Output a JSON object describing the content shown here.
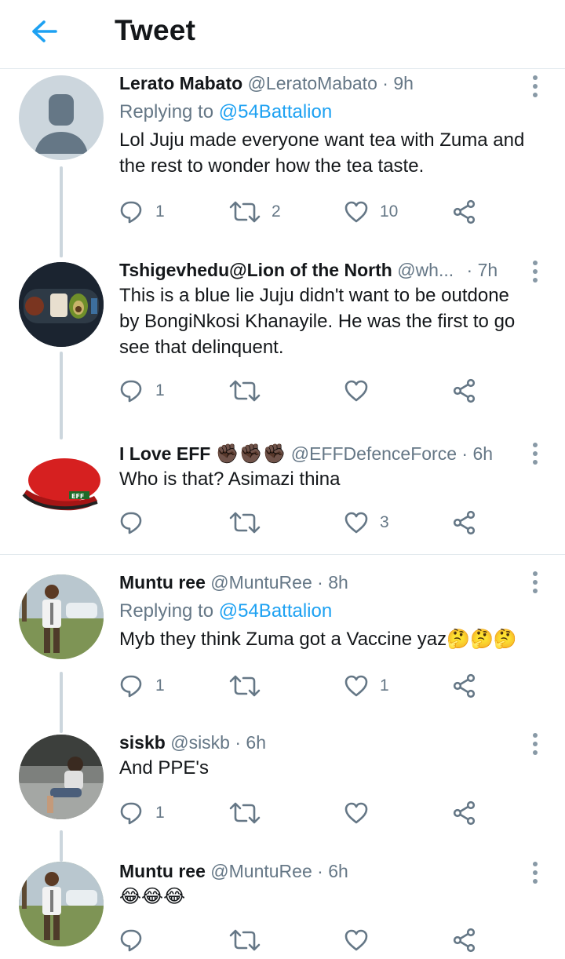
{
  "header": {
    "title": "Tweet",
    "back_icon": "arrow-left-icon",
    "accent": "#1da1f2"
  },
  "tweets": [
    {
      "name": "Lerato Mabato",
      "handle": "@LeratoMabato",
      "dot": "·",
      "time": "9h",
      "replying_prefix": "Replying to",
      "replying_to": "@54Battalion",
      "text": "Lol Juju made everyone want tea with Zuma and the rest to wonder how the tea taste.",
      "counts": {
        "reply": "1",
        "retweet": "2",
        "like": "10"
      },
      "avatar": "default-avatar"
    },
    {
      "name": "Tshigevhedu@Lion of the North",
      "handle": "@wh...",
      "dot": "·",
      "time": "7h",
      "text": "This is a blue lie Juju didn't want to be outdone by BongiNkosi Khanayile. He was the first to go see that delinquent.",
      "counts": {
        "reply": "1",
        "retweet": "",
        "like": ""
      },
      "avatar": "food-plate-avatar"
    },
    {
      "name": "I Love EFF",
      "name_emoji": "✊🏿✊🏿✊🏿",
      "handle": "@EFFDefenceForce",
      "dot": "·",
      "time": "6h",
      "text": "Who is that? Asimazi thina",
      "counts": {
        "reply": "",
        "retweet": "",
        "like": "3"
      },
      "avatar": "red-beret-avatar",
      "beret_label": "EFF"
    },
    {
      "name": "Muntu ree",
      "handle": "@MuntuRee",
      "dot": "·",
      "time": "8h",
      "replying_prefix": "Replying to",
      "replying_to": "@54Battalion",
      "text": "Myb they think Zuma got a Vaccine yaz",
      "text_emoji": "🤔🤔🤔",
      "counts": {
        "reply": "1",
        "retweet": "",
        "like": "1"
      },
      "avatar": "man-photo-avatar"
    },
    {
      "name": "siskb",
      "handle": "@siskb",
      "dot": "·",
      "time": "6h",
      "text": "And PPE's",
      "counts": {
        "reply": "1",
        "retweet": "",
        "like": ""
      },
      "avatar": "woman-photo-avatar"
    },
    {
      "name": "Muntu ree",
      "handle": "@MuntuRee",
      "dot": "·",
      "time": "6h",
      "text": "",
      "text_emoji": "😂😂😂",
      "counts": {
        "reply": "",
        "retweet": "",
        "like": ""
      },
      "avatar": "man-photo-avatar"
    }
  ]
}
